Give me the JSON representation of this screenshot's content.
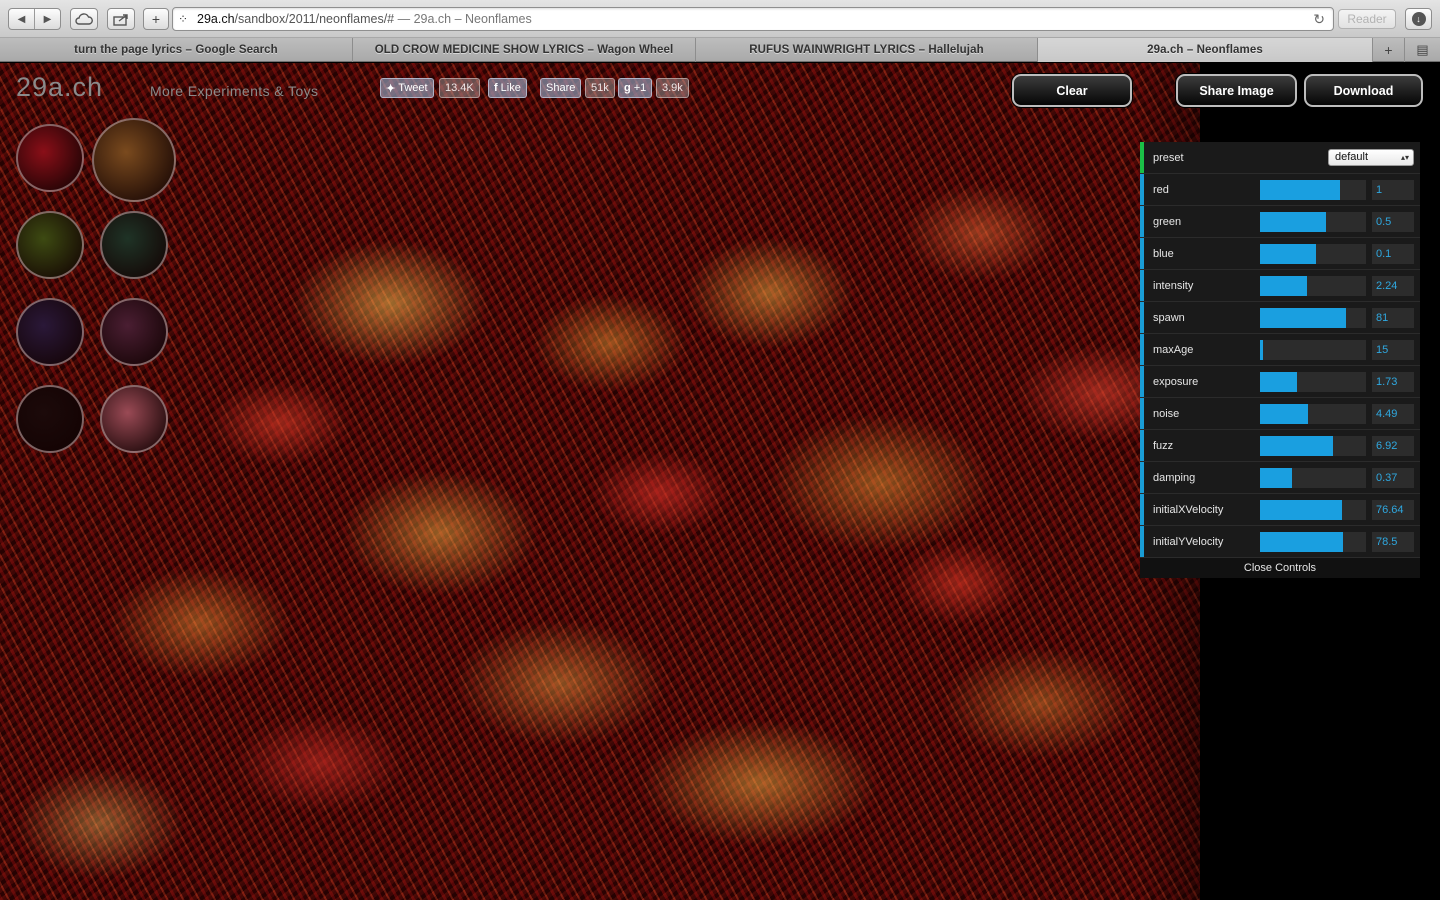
{
  "browser": {
    "url_domain": "29a.ch",
    "url_path": "/sandbox/2011/neonflames/#",
    "url_title": " — 29a.ch – Neonflames",
    "reader_label": "Reader",
    "tabs": [
      {
        "label": "turn the page lyrics – Google Search"
      },
      {
        "label": "OLD CROW MEDICINE SHOW LYRICS – Wagon Wheel"
      },
      {
        "label": "RUFUS WAINWRIGHT LYRICS – Hallelujah"
      },
      {
        "label": "29a.ch – Neonflames"
      }
    ]
  },
  "site": {
    "logo": "29a.ch",
    "tagline": "More Experiments & Toys"
  },
  "social": {
    "tweet_label": "Tweet",
    "tweet_count": "13.4K",
    "like_label": "Like",
    "share_label": "Share",
    "share_count": "51k",
    "gplus_label": "+1",
    "gplus_count": "3.9k"
  },
  "actions": {
    "clear": "Clear",
    "share_image": "Share Image",
    "download": "Download"
  },
  "swatches": [
    {
      "name": "swatch-red",
      "color": "#8a0f18"
    },
    {
      "name": "swatch-amber",
      "color": "#7a4a1e"
    },
    {
      "name": "swatch-olive",
      "color": "#3d4a12"
    },
    {
      "name": "swatch-teal",
      "color": "#1f3326"
    },
    {
      "name": "swatch-indigo",
      "color": "#2a1838"
    },
    {
      "name": "swatch-purple",
      "color": "#4a1e32"
    },
    {
      "name": "swatch-dark",
      "color": "#1c0a0a"
    },
    {
      "name": "swatch-pink",
      "color": "#9a4a55"
    }
  ],
  "controls": {
    "preset_label": "preset",
    "preset_value": "default",
    "params": [
      {
        "label": "red",
        "value": "1",
        "fill": 0.75
      },
      {
        "label": "green",
        "value": "0.5",
        "fill": 0.62
      },
      {
        "label": "blue",
        "value": "0.1",
        "fill": 0.53
      },
      {
        "label": "intensity",
        "value": "2.24",
        "fill": 0.44
      },
      {
        "label": "spawn",
        "value": "81",
        "fill": 0.81
      },
      {
        "label": "maxAge",
        "value": "15",
        "fill": 0.03
      },
      {
        "label": "exposure",
        "value": "1.73",
        "fill": 0.35
      },
      {
        "label": "noise",
        "value": "4.49",
        "fill": 0.45
      },
      {
        "label": "fuzz",
        "value": "6.92",
        "fill": 0.69
      },
      {
        "label": "damping",
        "value": "0.37",
        "fill": 0.3
      },
      {
        "label": "initialXVelocity",
        "value": "76.64",
        "fill": 0.77
      },
      {
        "label": "initialYVelocity",
        "value": "78.5",
        "fill": 0.78
      }
    ],
    "close_label": "Close Controls"
  }
}
